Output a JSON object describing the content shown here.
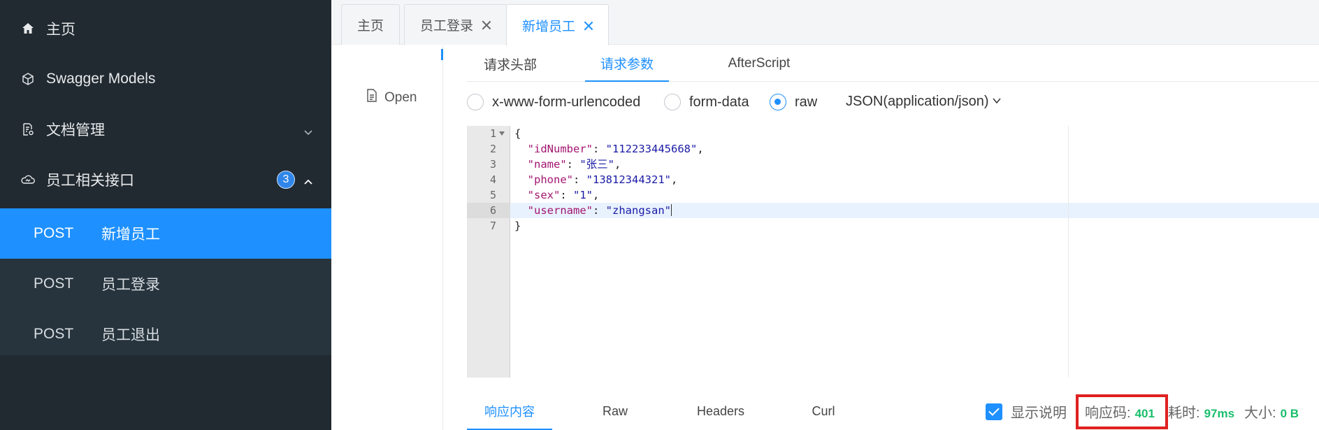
{
  "sidebar": {
    "items": [
      {
        "label": "主页",
        "icon": "home-icon"
      },
      {
        "label": "Swagger Models",
        "icon": "cube-icon"
      },
      {
        "label": "文档管理",
        "icon": "document-settings-icon"
      },
      {
        "label": "员工相关接口",
        "icon": "cloud-icon",
        "badge": "3"
      }
    ],
    "sub_items": [
      {
        "method": "POST",
        "name": "新增员工",
        "active": true
      },
      {
        "method": "POST",
        "name": "员工登录"
      },
      {
        "method": "POST",
        "name": "员工退出"
      }
    ]
  },
  "tabs": [
    {
      "label": "主页"
    },
    {
      "label": "员工登录"
    },
    {
      "label": "新增员工",
      "active": true
    }
  ],
  "left_panel": {
    "open_label": "Open"
  },
  "request_tabs": [
    {
      "label": "请求头部"
    },
    {
      "label": "请求参数",
      "active": true
    },
    {
      "label": "AfterScript"
    }
  ],
  "body_type": {
    "options": [
      "x-www-form-urlencoded",
      "form-data",
      "raw"
    ],
    "selected": "raw",
    "content_type": "JSON(application/json)"
  },
  "editor": {
    "line_numbers": [
      "1",
      "2",
      "3",
      "4",
      "5",
      "6",
      "7"
    ],
    "open_brace": "{",
    "close_brace": "}",
    "fields": [
      {
        "key": "\"idNumber\"",
        "value": "\"112233445668\"",
        "comma": ","
      },
      {
        "key": "\"name\"",
        "value": "\"张三\"",
        "comma": ","
      },
      {
        "key": "\"phone\"",
        "value": "\"13812344321\"",
        "comma": ","
      },
      {
        "key": "\"sex\"",
        "value": "\"1\"",
        "comma": ","
      },
      {
        "key": "\"username\"",
        "value": "\"zhangsan\"",
        "comma": ""
      }
    ]
  },
  "response_tabs": [
    {
      "label": "响应内容",
      "active": true
    },
    {
      "label": "Raw"
    },
    {
      "label": "Headers"
    },
    {
      "label": "Curl"
    }
  ],
  "response_status": {
    "show_desc_label": "显示说明",
    "code_label": "响应码:",
    "code": "401",
    "time_label": "耗时:",
    "time": "97ms",
    "size_label": "大小:",
    "size": "0 B"
  },
  "colors": {
    "sidebar_bg": "#212a31",
    "accent": "#1e90ff",
    "success": "#19be6b",
    "highlight_box": "#e02020"
  }
}
